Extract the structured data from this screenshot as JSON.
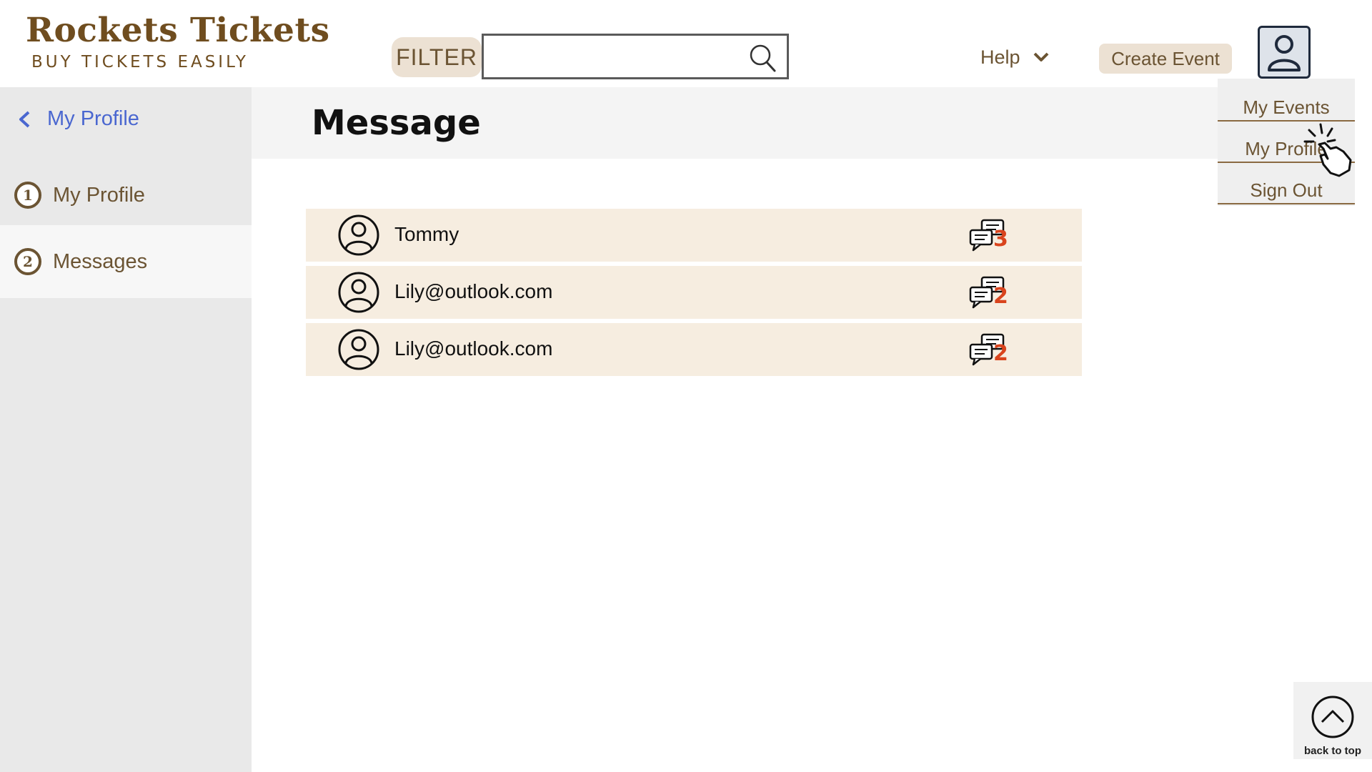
{
  "brand": {
    "title": "Rockets Tickets",
    "subtitle": "BUY TICKETS EASILY"
  },
  "header": {
    "filter_label": "FILTER",
    "search_value": "",
    "help_label": "Help",
    "create_event_label": "Create Event"
  },
  "dropdown": {
    "items": [
      {
        "label": "My Events"
      },
      {
        "label": "My Profile"
      },
      {
        "label": "Sign Out"
      }
    ]
  },
  "sidebar": {
    "back_label": "My Profile",
    "items": [
      {
        "number": "1",
        "label": "My Profile",
        "active": false
      },
      {
        "number": "2",
        "label": "Messages",
        "active": true
      }
    ]
  },
  "main": {
    "title": "Message",
    "messages": [
      {
        "name": "Tommy",
        "count": "3"
      },
      {
        "name": "Lily@outlook.com",
        "count": "2"
      },
      {
        "name": "Lily@outlook.com",
        "count": "2"
      }
    ]
  },
  "back_to_top": {
    "label": "back to top"
  },
  "colors": {
    "brand_brown": "#6f4d1f",
    "accent_blue": "#4a67d0",
    "badge_red": "#d9441d",
    "row_bg": "#f6ede0",
    "chip_bg": "#ece1d3"
  },
  "icons": [
    "search-icon",
    "chevron-down-icon",
    "user-icon",
    "chevron-left-icon",
    "user-circle-icon",
    "chat-bubbles-icon",
    "pointer-click-icon",
    "arrow-up-circle-icon"
  ]
}
